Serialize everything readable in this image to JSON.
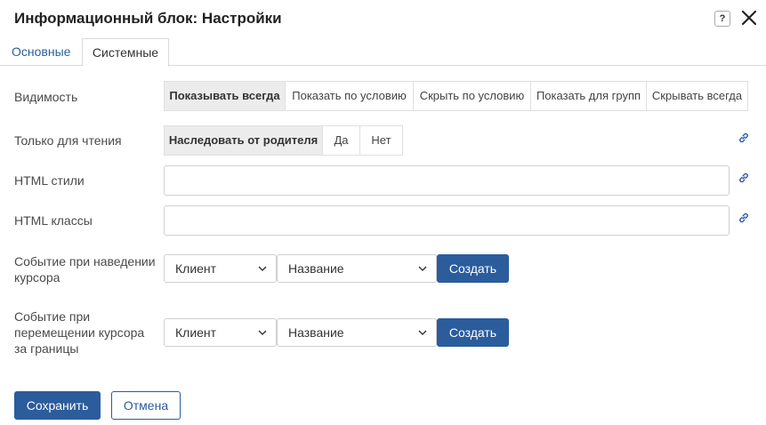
{
  "dialog": {
    "title": "Информационный блок: Настройки",
    "help_label": "?"
  },
  "tabs": [
    {
      "label": "Основные",
      "active": false
    },
    {
      "label": "Системные",
      "active": true
    }
  ],
  "visibility": {
    "label": "Видимость",
    "options": [
      "Показывать всегда",
      "Показать по условию",
      "Скрыть по условию",
      "Показать для групп",
      "Скрывать всегда"
    ],
    "selected": "Показывать всегда"
  },
  "readonly": {
    "label": "Только для чтения",
    "options": [
      "Наследовать от родителя",
      "Да",
      "Нет"
    ],
    "selected": "Наследовать от родителя"
  },
  "html_styles": {
    "label": "HTML стили",
    "value": ""
  },
  "html_classes": {
    "label": "HTML классы",
    "value": ""
  },
  "hover_event": {
    "label_line1": "Событие при наведении",
    "label_line2": "курсора",
    "source": "Клиент",
    "name": "Название",
    "create_label": "Создать"
  },
  "leave_event": {
    "label_line1": "Событие при",
    "label_line2": "перемещении курсора",
    "label_line3": "за границы",
    "source": "Клиент",
    "name": "Название",
    "create_label": "Создать"
  },
  "footer": {
    "save_label": "Сохранить",
    "cancel_label": "Отмена"
  },
  "colors": {
    "accent": "#2b5c9c",
    "tab_link": "#2a5d9f"
  }
}
